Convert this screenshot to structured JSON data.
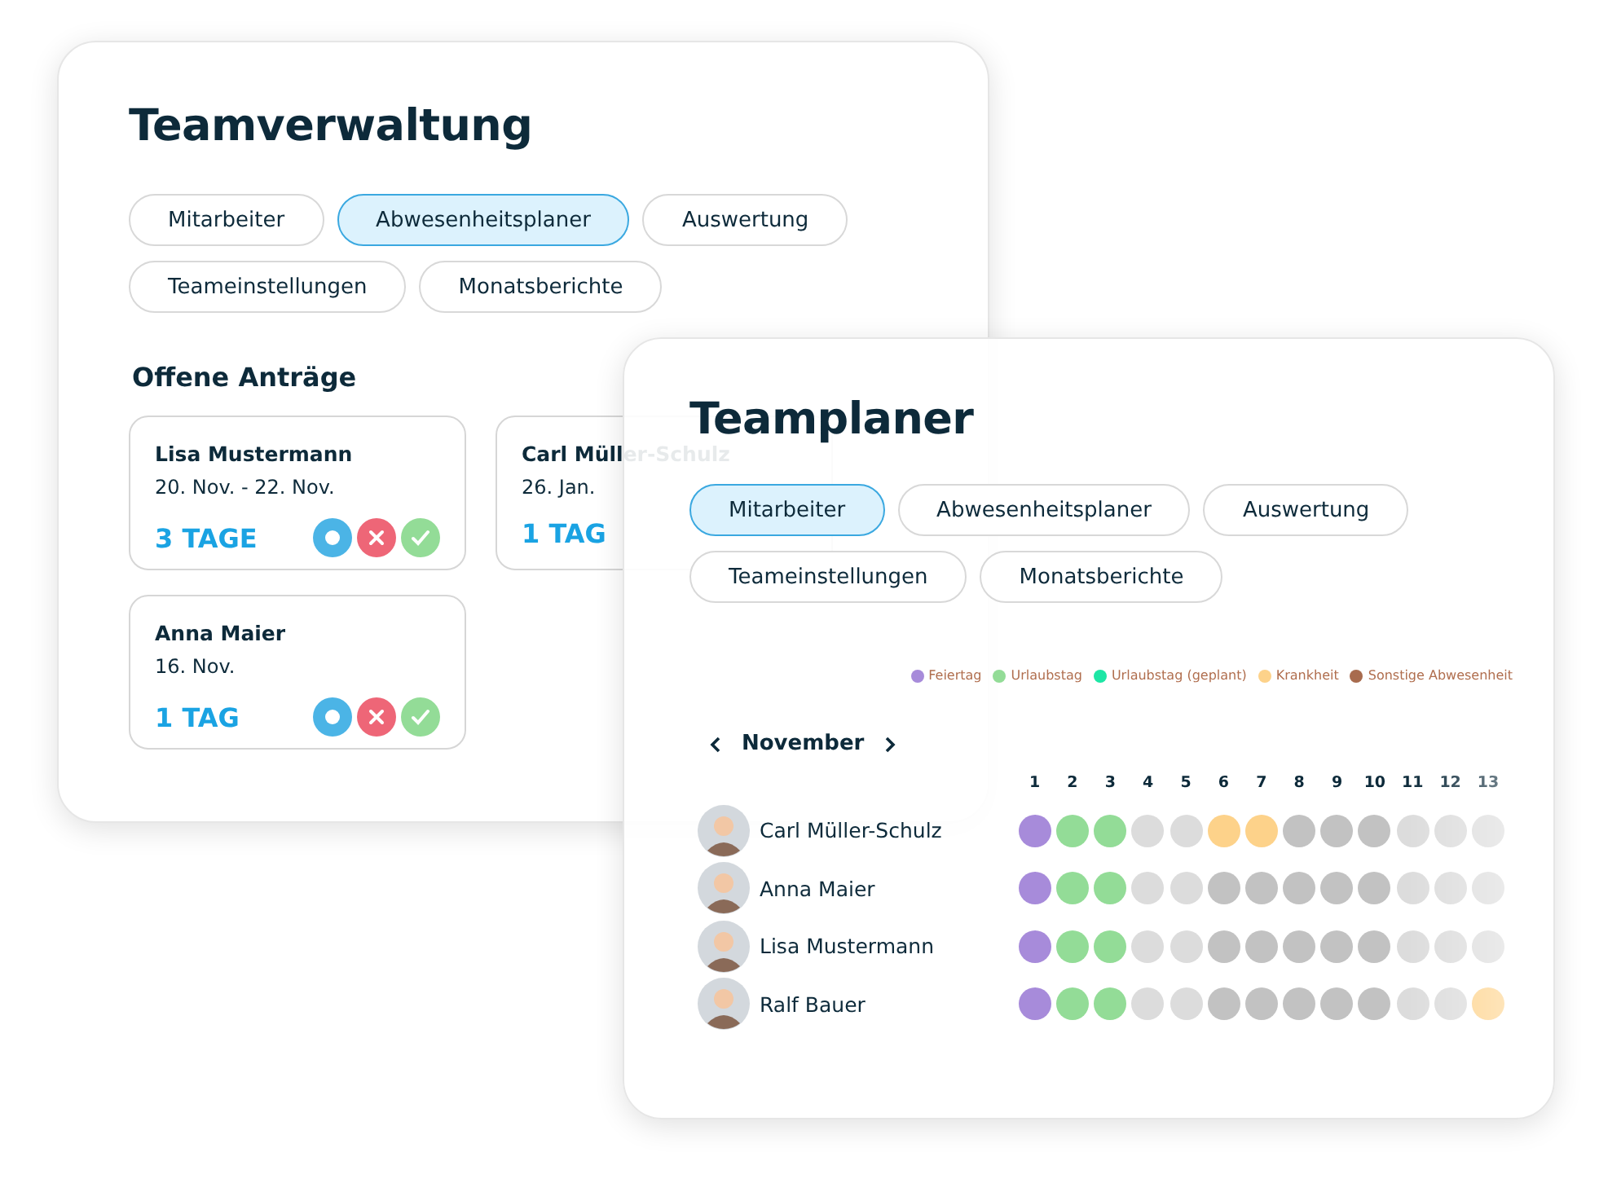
{
  "team_management": {
    "title": "Teamverwaltung",
    "tabs": [
      {
        "label": "Mitarbeiter",
        "selected": false
      },
      {
        "label": "Abwesenheitsplaner",
        "selected": true
      },
      {
        "label": "Auswertung",
        "selected": false
      },
      {
        "label": "Teameinstellungen",
        "selected": false
      },
      {
        "label": "Monatsberichte",
        "selected": false
      }
    ],
    "section_title": "Offene Anträge",
    "requests": [
      {
        "name": "Lisa Mustermann",
        "dates": "20. Nov. - 22. Nov.",
        "duration": "3 TAGE",
        "actions": [
          {
            "kind": "pending"
          },
          {
            "kind": "reject"
          },
          {
            "kind": "approve"
          }
        ]
      },
      {
        "name": "Carl Müller-Schulz",
        "dates": "26. Jan.",
        "duration": "1 TAG"
      },
      {
        "name": "Anna Maier",
        "dates": "16. Nov.",
        "duration": "1 TAG",
        "actions": [
          {
            "kind": "pending"
          },
          {
            "kind": "reject"
          },
          {
            "kind": "approve"
          }
        ]
      }
    ]
  },
  "team_planner": {
    "title": "Teamplaner",
    "tabs": [
      {
        "label": "Mitarbeiter",
        "selected": true
      },
      {
        "label": "Abwesenheitsplaner",
        "selected": false
      },
      {
        "label": "Auswertung",
        "selected": false
      },
      {
        "label": "Teameinstellungen",
        "selected": false
      },
      {
        "label": "Monatsberichte",
        "selected": false
      }
    ],
    "legend": [
      {
        "label": "Feiertag",
        "color": "#a78bda"
      },
      {
        "label": "Urlaubstag",
        "color": "#93dc97"
      },
      {
        "label": "Urlaubstag (geplant)",
        "color": "#1de6a5"
      },
      {
        "label": "Krankheit",
        "color": "#fdd28a"
      },
      {
        "label": "Sonstige Abwesenheit",
        "color": "#a86b4e"
      }
    ],
    "month": "November",
    "days": [
      "1",
      "2",
      "3",
      "4",
      "5",
      "6",
      "7",
      "8",
      "9",
      "10",
      "11",
      "12",
      "13"
    ],
    "members": [
      {
        "name": "Carl Müller-Schulz",
        "days": [
          {
            "kind": "holiday"
          },
          {
            "kind": "vacation"
          },
          {
            "kind": "vacation"
          },
          {
            "kind": "free"
          },
          {
            "kind": "free"
          },
          {
            "kind": "sick"
          },
          {
            "kind": "sick"
          },
          {
            "kind": "work"
          },
          {
            "kind": "work"
          },
          {
            "kind": "work"
          },
          {
            "kind": "free"
          },
          {
            "kind": "free"
          },
          {
            "kind": "free"
          }
        ]
      },
      {
        "name": "Anna Maier",
        "days": [
          {
            "kind": "holiday"
          },
          {
            "kind": "vacation"
          },
          {
            "kind": "vacation"
          },
          {
            "kind": "free"
          },
          {
            "kind": "free"
          },
          {
            "kind": "work"
          },
          {
            "kind": "work"
          },
          {
            "kind": "work"
          },
          {
            "kind": "work"
          },
          {
            "kind": "work"
          },
          {
            "kind": "free"
          },
          {
            "kind": "free"
          },
          {
            "kind": "free"
          }
        ]
      },
      {
        "name": "Lisa Mustermann",
        "days": [
          {
            "kind": "holiday"
          },
          {
            "kind": "vacation"
          },
          {
            "kind": "vacation"
          },
          {
            "kind": "free"
          },
          {
            "kind": "free"
          },
          {
            "kind": "work"
          },
          {
            "kind": "work"
          },
          {
            "kind": "work"
          },
          {
            "kind": "work"
          },
          {
            "kind": "work"
          },
          {
            "kind": "free"
          },
          {
            "kind": "free"
          },
          {
            "kind": "free"
          }
        ]
      },
      {
        "name": "Ralf Bauer",
        "days": [
          {
            "kind": "holiday"
          },
          {
            "kind": "vacation"
          },
          {
            "kind": "vacation"
          },
          {
            "kind": "free"
          },
          {
            "kind": "free"
          },
          {
            "kind": "work"
          },
          {
            "kind": "work"
          },
          {
            "kind": "work"
          },
          {
            "kind": "work"
          },
          {
            "kind": "work"
          },
          {
            "kind": "free"
          },
          {
            "kind": "free"
          },
          {
            "kind": "sick"
          }
        ]
      }
    ]
  }
}
